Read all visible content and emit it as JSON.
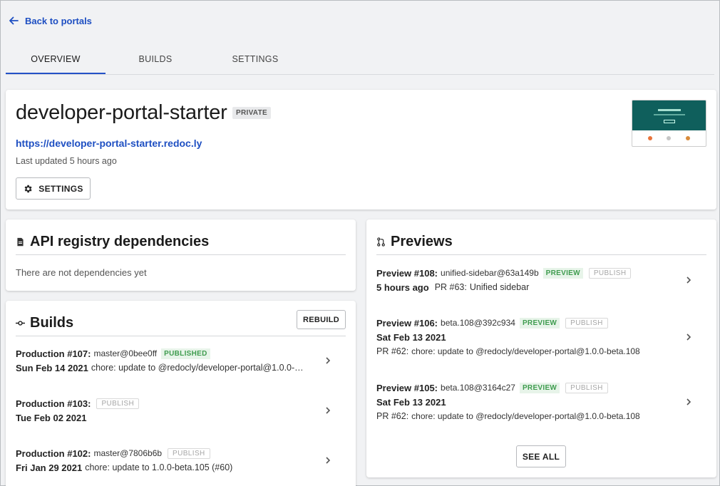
{
  "nav": {
    "back_label": "Back to portals"
  },
  "tabs": [
    {
      "label": "OVERVIEW",
      "active": true
    },
    {
      "label": "BUILDS",
      "active": false
    },
    {
      "label": "SETTINGS",
      "active": false
    }
  ],
  "portal": {
    "name": "developer-portal-starter",
    "visibility": "PRIVATE",
    "url": "https://developer-portal-starter.redoc.ly",
    "last_updated": "Last updated 5 hours ago",
    "settings_label": "SETTINGS",
    "thumbnail_icon": "site-preview-thumbnail"
  },
  "dependencies": {
    "title": "API registry dependencies",
    "empty_text": "There are not dependencies yet"
  },
  "builds": {
    "title": "Builds",
    "rebuild_label": "REBUILD",
    "items": [
      {
        "title": "Production #107:",
        "ref": "master@0bee0ff",
        "badge": "PUBLISHED",
        "date": "Sun Feb 14 2021",
        "message": "chore: update to @redocly/developer-portal@1.0.0-…"
      },
      {
        "title": "Production #103:",
        "ref": "",
        "badge": "PUBLISH",
        "date": "Tue Feb 02 2021",
        "message": ""
      },
      {
        "title": "Production #102:",
        "ref": "master@7806b6b",
        "badge": "PUBLISH",
        "date": "Fri Jan 29 2021",
        "message": "chore: update to 1.0.0-beta.105 (#60)"
      }
    ]
  },
  "previews": {
    "title": "Previews",
    "see_all_label": "SEE ALL",
    "items": [
      {
        "title": "Preview #108:",
        "ref": "unified-sidebar@63a149b",
        "badge_preview": "PREVIEW",
        "badge_publish": "PUBLISH",
        "date": "5 hours ago",
        "pr": "PR #63:",
        "message": "Unified sidebar"
      },
      {
        "title": "Preview #106:",
        "ref": "beta.108@392c934",
        "badge_preview": "PREVIEW",
        "badge_publish": "PUBLISH",
        "date": "Sat Feb 13 2021",
        "pr": "PR #62:",
        "message": "chore: update to @redocly/developer-portal@1.0.0-beta.108"
      },
      {
        "title": "Preview #105:",
        "ref": "beta.108@3164c27",
        "badge_preview": "PREVIEW",
        "badge_publish": "PUBLISH",
        "date": "Sat Feb 13 2021",
        "pr": "PR #62:",
        "message": "chore: update to @redocly/developer-portal@1.0.0-beta.108"
      }
    ]
  },
  "colors": {
    "link": "#1e4fc2",
    "tab_active": "#2452c7",
    "badge_green": "#3f9c4f"
  }
}
